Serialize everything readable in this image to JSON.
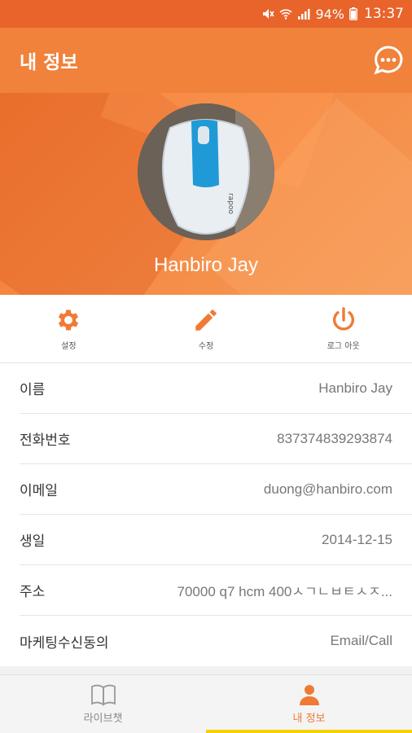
{
  "status_bar": {
    "battery": "94%",
    "time": "13:37",
    "icons": [
      "mute-icon",
      "wifi-icon",
      "signal-icon",
      "battery-icon"
    ]
  },
  "app_bar": {
    "title": "내 정보",
    "chat_icon": "chat-bubble-icon"
  },
  "profile": {
    "name": "Hanbiro Jay"
  },
  "actions": [
    {
      "label": "설정",
      "icon": "gear-icon"
    },
    {
      "label": "수정",
      "icon": "pencil-icon"
    },
    {
      "label": "로그 아웃",
      "icon": "power-icon"
    }
  ],
  "info": [
    {
      "key": "이름",
      "value": "Hanbiro Jay"
    },
    {
      "key": "전화번호",
      "value": "837374839293874"
    },
    {
      "key": "이메일",
      "value": "duong@hanbiro.com"
    },
    {
      "key": "생일",
      "value": "2014-12-15"
    },
    {
      "key": "주소",
      "value": "70000 q7 hcm 400ㅅㄱㄴㅂㅌㅅㅈ..."
    },
    {
      "key": "마케팅수신동의",
      "value": "Email/Call"
    }
  ],
  "bottom_nav": [
    {
      "label": "라이브챗",
      "icon": "book-icon",
      "active": false
    },
    {
      "label": "내 정보",
      "icon": "person-icon",
      "active": true
    }
  ],
  "colors": {
    "accent": "#f07a35",
    "status_bar": "#e8642a",
    "active_indicator": "#f5d000"
  }
}
